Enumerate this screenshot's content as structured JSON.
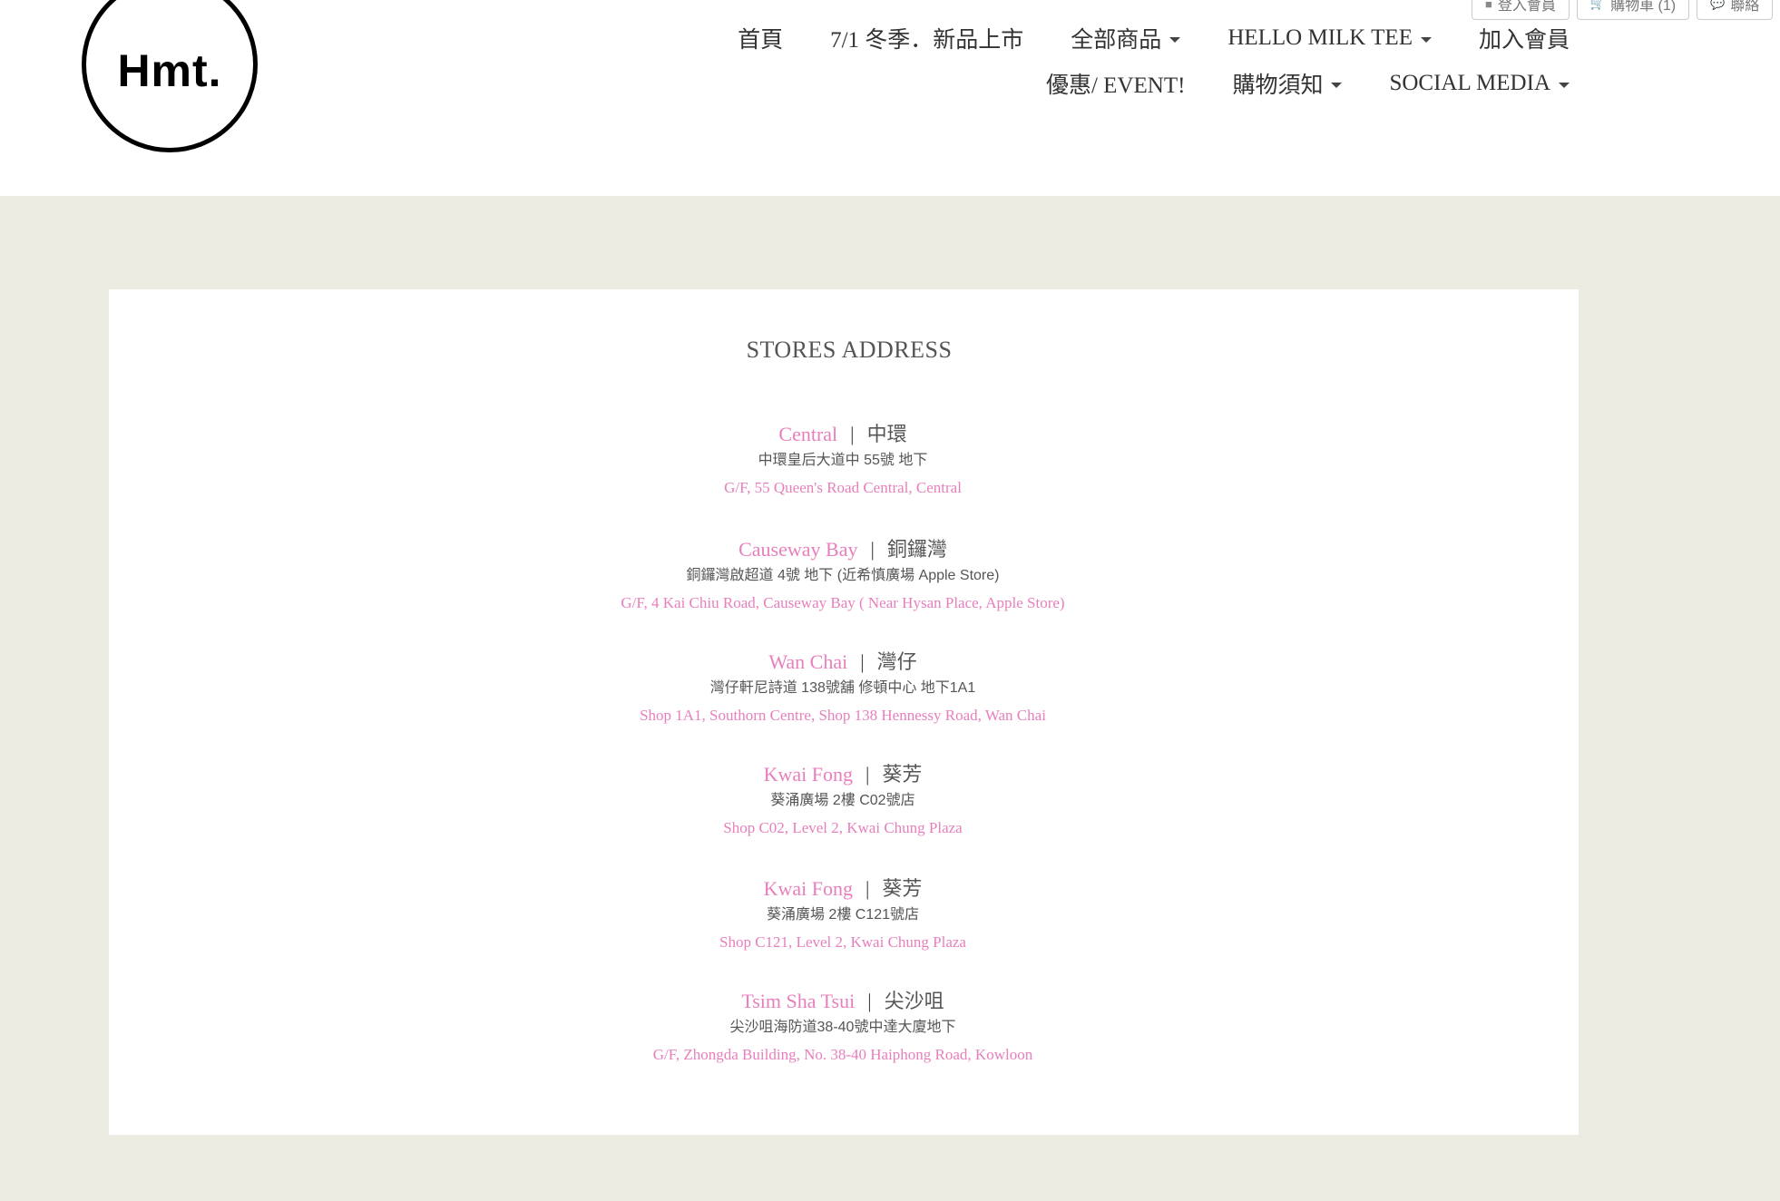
{
  "logo": {
    "text": "Hmt."
  },
  "util_bar": {
    "login": "登入會員",
    "cart": "購物車 (1)",
    "contact": "聯絡"
  },
  "nav": {
    "row1": [
      {
        "label": "首頁",
        "dropdown": false
      },
      {
        "label": "7/1 冬季．新品上市",
        "dropdown": false
      },
      {
        "label": "全部商品",
        "dropdown": true
      },
      {
        "label": "HELLO MILK TEE",
        "dropdown": true
      },
      {
        "label": "加入會員",
        "dropdown": false
      }
    ],
    "row2": [
      {
        "label": "優惠/ EVENT!",
        "dropdown": false
      },
      {
        "label": "購物須知",
        "dropdown": true
      },
      {
        "label": "SOCIAL MEDIA",
        "dropdown": true
      }
    ]
  },
  "page": {
    "title": "STORES ADDRESS"
  },
  "stores": [
    {
      "en": "Central",
      "zh": "中環",
      "zh_address": "中環皇后大道中 55號 地下",
      "en_address": "G/F, 55 Queen's Road Central, Central"
    },
    {
      "en": "Causeway Bay",
      "zh": "銅鑼灣",
      "zh_address": "銅鑼灣啟超道 4號 地下 (近希慎廣場 Apple Store)",
      "en_address": "G/F, 4 Kai Chiu Road, Causeway Bay ( Near Hysan Place, Apple Store)"
    },
    {
      "en": "Wan Chai",
      "zh": "灣仔",
      "zh_address": "灣仔軒尼詩道 138號舖 修頓中心 地下1A1",
      "en_address": "Shop 1A1, Southorn Centre, Shop 138 Hennessy Road, Wan Chai"
    },
    {
      "en": "Kwai Fong",
      "zh": "葵芳",
      "zh_address": "葵涌廣場 2樓 C02號店",
      "en_address": "Shop C02, Level 2, Kwai Chung Plaza"
    },
    {
      "en": "Kwai Fong",
      "zh": "葵芳",
      "zh_address": "葵涌廣場 2樓 C121號店",
      "en_address": "Shop C121, Level 2, Kwai Chung Plaza"
    },
    {
      "en": "Tsim Sha Tsui",
      "zh": "尖沙咀",
      "zh_address": "尖沙咀海防道38-40號中達大廈地下",
      "en_address": "G/F, Zhongda Building, No. 38-40 Haiphong Road, Kowloon"
    }
  ],
  "colors": {
    "accent_pink": "#e87fbd",
    "background": "#ecece2",
    "card": "#ffffff",
    "text": "#555555"
  }
}
